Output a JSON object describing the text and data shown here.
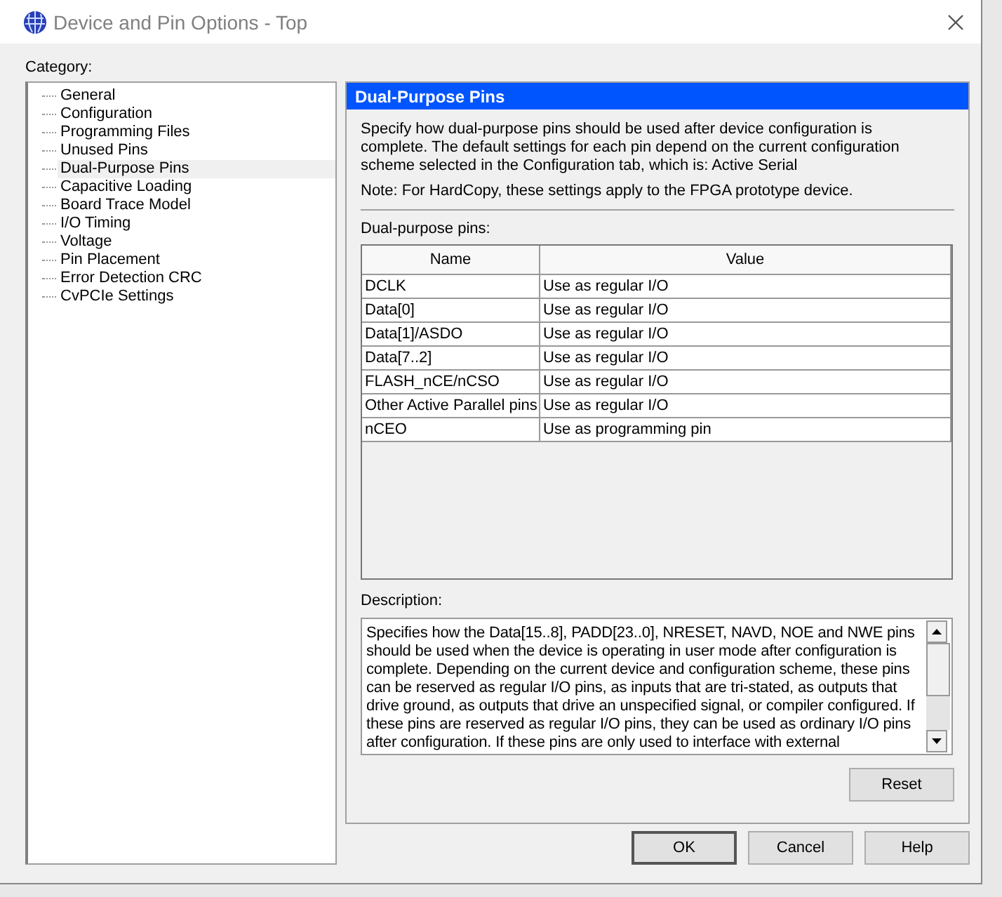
{
  "window": {
    "title": "Device and Pin Options - Top"
  },
  "category_label": "Category:",
  "categories": [
    {
      "label": "General",
      "selected": false
    },
    {
      "label": "Configuration",
      "selected": false
    },
    {
      "label": "Programming Files",
      "selected": false
    },
    {
      "label": "Unused Pins",
      "selected": false
    },
    {
      "label": "Dual-Purpose Pins",
      "selected": true
    },
    {
      "label": "Capacitive Loading",
      "selected": false
    },
    {
      "label": "Board Trace Model",
      "selected": false
    },
    {
      "label": "I/O Timing",
      "selected": false
    },
    {
      "label": "Voltage",
      "selected": false
    },
    {
      "label": "Pin Placement",
      "selected": false
    },
    {
      "label": "Error Detection CRC",
      "selected": false
    },
    {
      "label": "CvPCIe Settings",
      "selected": false
    }
  ],
  "panel": {
    "title": "Dual-Purpose Pins",
    "intro": "Specify how dual-purpose pins should be used after device configuration is complete. The default settings for each pin depend on the current configuration scheme selected in the Configuration tab, which is:  Active Serial",
    "note": "Note: For HardCopy, these settings apply to the FPGA prototype device.",
    "table_label": "Dual-purpose pins:",
    "table": {
      "columns": [
        "Name",
        "Value"
      ],
      "rows": [
        [
          "DCLK",
          "Use as regular I/O"
        ],
        [
          "Data[0]",
          "Use as regular I/O"
        ],
        [
          "Data[1]/ASDO",
          "Use as regular I/O"
        ],
        [
          "Data[7..2]",
          "Use as regular I/O"
        ],
        [
          "FLASH_nCE/nCSO",
          "Use as regular I/O"
        ],
        [
          "Other Active Parallel pins",
          "Use as regular I/O"
        ],
        [
          "nCEO",
          "Use as programming pin"
        ]
      ]
    },
    "description_label": "Description:",
    "description": "Specifies how the Data[15..8], PADD[23..0], NRESET, NAVD, NOE and NWE pins should be used when the device is operating in user mode after configuration is complete. Depending on the current device and configuration scheme, these pins can be reserved as regular I/O pins, as inputs that are tri-stated, as outputs that drive ground, as outputs that drive an unspecified signal, or compiler configured. If these pins are reserved as regular I/O pins, they can be used as ordinary I/O pins after configuration. If these pins are only used to interface with external",
    "reset_button": "Reset"
  },
  "buttons": [
    "OK",
    "Cancel",
    "Help"
  ]
}
